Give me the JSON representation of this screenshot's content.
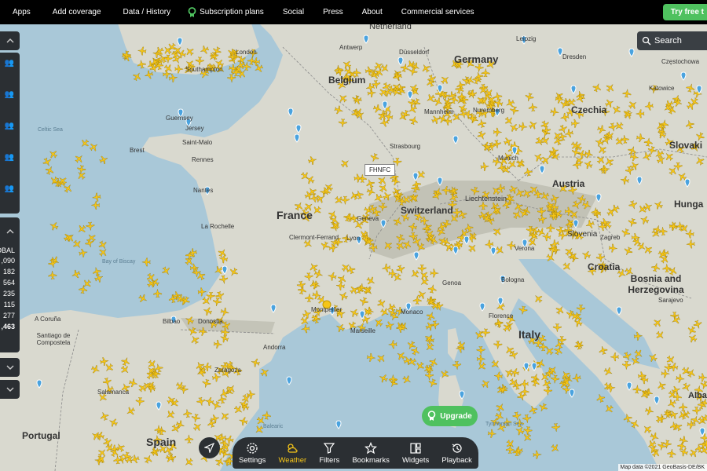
{
  "topnav": {
    "items": [
      "Apps",
      "Add coverage",
      "Data / History",
      "Subscription plans",
      "Social",
      "Press",
      "About",
      "Commercial services"
    ],
    "trial_label": "Try free t"
  },
  "search": {
    "label": "Search"
  },
  "stats": {
    "title": "OBAL",
    "values": [
      ",090",
      "182",
      "564",
      "235",
      "115",
      "277",
      ",463"
    ]
  },
  "map_labels": {
    "countries": [
      "Netherland",
      "Germany",
      "Belgium",
      "Czechia",
      "France",
      "Austria",
      "Switzerland",
      "Liechtenstein",
      "Slovenia",
      "Croatia",
      "Bosnia and Herzegovina",
      "Italy",
      "Spain",
      "Portugal",
      "Slovaki",
      "Hunga",
      "Alba"
    ],
    "cities": [
      "Southampton",
      "London",
      "Antwerp",
      "Düsseldorf",
      "Leipzig",
      "Dresden",
      "Częstochowa",
      "Katowice",
      "Guernsey",
      "Jersey",
      "Celtic Sea",
      "Mannheim",
      "Nuremberg",
      "Brest",
      "Saint-Malo",
      "Rennes",
      "Strasbourg",
      "Munich",
      "Nantes",
      "La Rochelle",
      "Clermont-Ferrand",
      "Lyon",
      "Geneva",
      "Verona",
      "Zagreb",
      "Bologna",
      "Genoa",
      "Florence",
      "Sarajevo",
      "Montpellier",
      "Marseille",
      "Monaco",
      "Bilbao",
      "Donostia",
      "A Coruña",
      "Santiago de Compostela",
      "Zaragoza",
      "Andorra",
      "Salamanca",
      "Tyrrhenian Sea",
      "Bay of Biscay",
      "Balearic"
    ],
    "flight_tag": "FHNFC"
  },
  "toolbar": {
    "items": [
      {
        "label": "Settings",
        "icon": "gear-icon"
      },
      {
        "label": "Weather",
        "icon": "weather-icon"
      },
      {
        "label": "Filters",
        "icon": "filter-icon"
      },
      {
        "label": "Bookmarks",
        "icon": "star-icon"
      },
      {
        "label": "Widgets",
        "icon": "widgets-icon"
      },
      {
        "label": "Playback",
        "icon": "history-icon"
      }
    ]
  },
  "upgrade": {
    "label": "Upgrade"
  },
  "attribution": "Map data ©2021 GeoBasis-DE/BK",
  "colors": {
    "land": "#d9d9cf",
    "sea": "#a9c8d8",
    "plane": "#f5c518",
    "accent": "#4fc15f",
    "panel": "#2b2f33"
  }
}
